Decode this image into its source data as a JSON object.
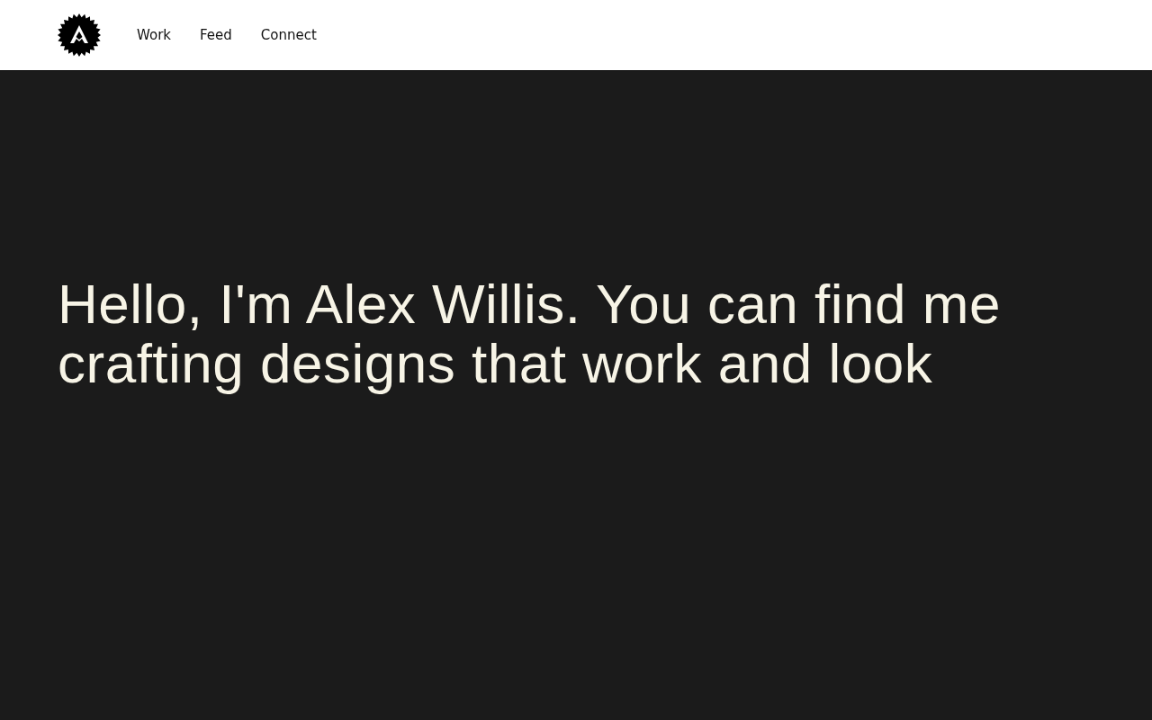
{
  "nav": {
    "items": [
      {
        "label": "Work"
      },
      {
        "label": "Feed"
      },
      {
        "label": "Connect"
      }
    ]
  },
  "hero": {
    "lines": [
      "Hello, I'm Alex Willis. You can find me",
      "crafting designs that work and look"
    ]
  }
}
